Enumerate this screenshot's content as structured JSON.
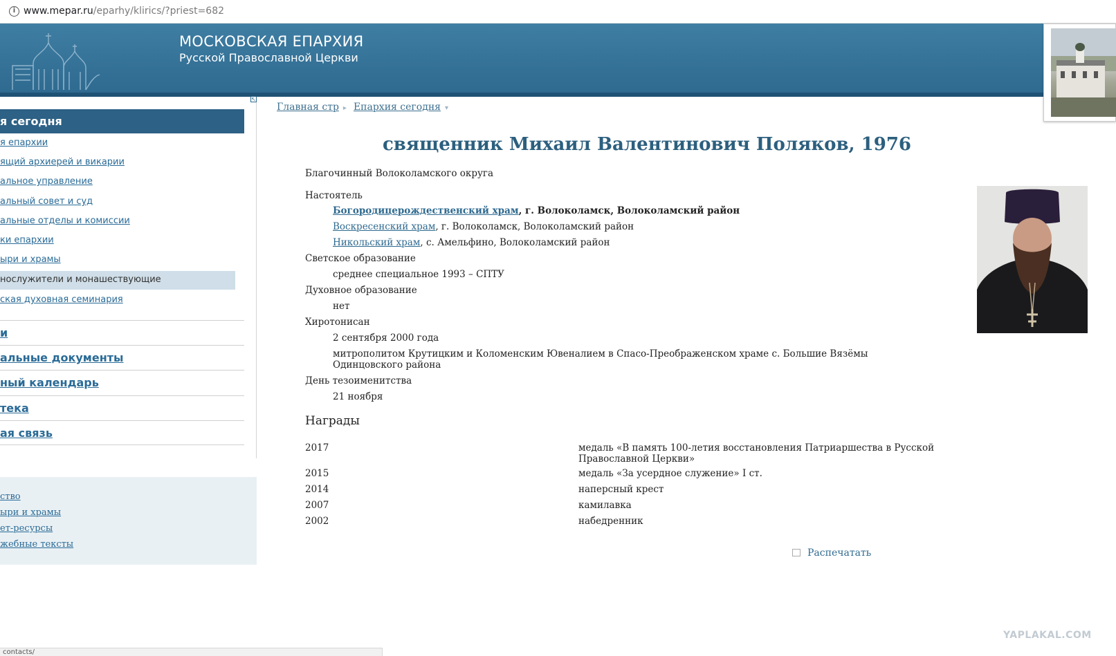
{
  "browser": {
    "url_host": "www.mepar.ru",
    "url_path": "/eparhy/klirics/?priest=682",
    "status_text": "contacts/"
  },
  "header": {
    "title": "МОСКОВСКАЯ ЕПАРХИЯ",
    "subtitle": "Русской Православной Церкви"
  },
  "sidebar": {
    "collapse_icon": "collapse-icon",
    "section_title": "я сегодня",
    "items": [
      "я епархии",
      "ящий архиерей и викарии",
      "альное управление",
      "альный совет и суд",
      "альные отделы и комиссии",
      "ки епархии",
      "ыри и храмы",
      "нослужители и монашествующие",
      "ская духовная семинария"
    ],
    "big_items": [
      "и",
      "альные документы",
      "ный календарь",
      "тека",
      "ая связь"
    ],
    "box_links": [
      "ство",
      "ыри и храмы",
      "ет-ресурсы",
      "жебные тексты"
    ]
  },
  "breadcrumb": {
    "home": "Главная стр",
    "section": "Епархия сегодня"
  },
  "priest": {
    "title": "священник Михаил Валентинович Поляков, 1976",
    "position": "Благочинный Волоколамского округа",
    "rector_label": "Настоятель",
    "churches": [
      {
        "name": "Богородицерождественский храм",
        "rest": ", г. Волоколамск, Волоколамский район",
        "bold": true
      },
      {
        "name": "Воскресенский храм",
        "rest": ", г. Волоколамск, Волоколамский район",
        "bold": false
      },
      {
        "name": "Никольский храм",
        "rest": ", с. Амельфино, Волоколамский район",
        "bold": false
      }
    ],
    "secular_edu_label": "Светское образование",
    "secular_edu_value": "среднее специальное 1993 – СПТУ",
    "spiritual_edu_label": "Духовное образование",
    "spiritual_edu_value": "нет",
    "ordained_label": "Хиротонисан",
    "ordained_date": "2 сентября 2000 года",
    "ordained_by_line1": "митрополитом Крутицким и Коломенским Ювеналием в Спасо-Преображенском храме с. Большие Вязёмы",
    "ordained_by_line2": "Одинцовского района",
    "nameday_label": "День тезоименитства",
    "nameday_value": "21 ноября"
  },
  "awards": {
    "heading": "Награды",
    "rows": [
      {
        "year": "2017",
        "line1": "медаль «В память 100-летия восстановления Патриаршества в Русской",
        "line2": "Православной Церкви»"
      },
      {
        "year": "2015",
        "line1": "медаль «За усердное служение» I ст.",
        "line2": ""
      },
      {
        "year": "2014",
        "line1": "наперсный крест",
        "line2": ""
      },
      {
        "year": "2007",
        "line1": "камилавка",
        "line2": ""
      },
      {
        "year": "2002",
        "line1": "набедренник",
        "line2": ""
      }
    ]
  },
  "print_label": "Распечатать",
  "watermark": "YAPLAKAL.COM",
  "colors": {
    "banner": "#3a789e",
    "sidebar_head": "#2d6185",
    "link": "#2f6a90",
    "title": "#2c5f7e"
  }
}
